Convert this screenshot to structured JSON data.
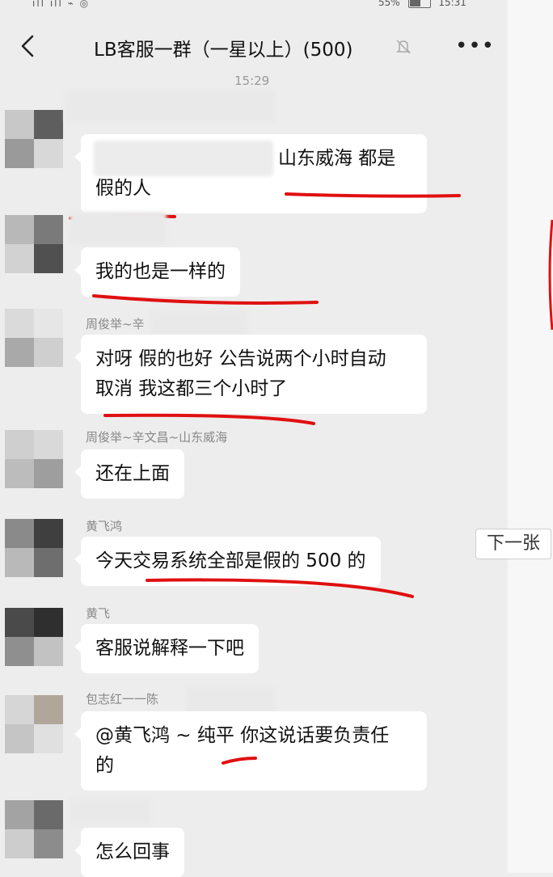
{
  "status_bar": {
    "left_text": "ıll ıll ⌁ ◎",
    "battery": "55%",
    "time": "15:31"
  },
  "header": {
    "title": "LB客服一群（一星以上）(500)",
    "back_icon": "chevron-left-icon",
    "mute_icon": "bell-off-icon",
    "more_icon": "more-dots-icon"
  },
  "timestamp": "15:29",
  "messages": [
    {
      "sender": "",
      "text": [
        "山东威海  都是",
        "假的人"
      ]
    },
    {
      "sender": "",
      "text": [
        "我的也是一样的"
      ]
    },
    {
      "sender": "周俊举~辛",
      "text": [
        "对呀 假的也好 公告说两个小时自动",
        "取消 我这都三个小时了"
      ]
    },
    {
      "sender": "周俊举~辛文昌~山东威海",
      "text": [
        "还在上面"
      ]
    },
    {
      "sender": "黄飞鸿",
      "text": [
        "今天交易系统全部是假的 500 的"
      ]
    },
    {
      "sender": "黄飞",
      "text": [
        "客服说解释一下吧"
      ]
    },
    {
      "sender": "包志红一一陈",
      "text": [
        "@黄飞鸿 ~ 纯平  你这说话要负责任",
        "的"
      ]
    },
    {
      "sender": "",
      "text": [
        "怎么回事"
      ]
    }
  ],
  "next_button": "下一张",
  "colors": {
    "background": "#ededed",
    "bubble": "#ffffff",
    "annotation": "#e01010"
  }
}
